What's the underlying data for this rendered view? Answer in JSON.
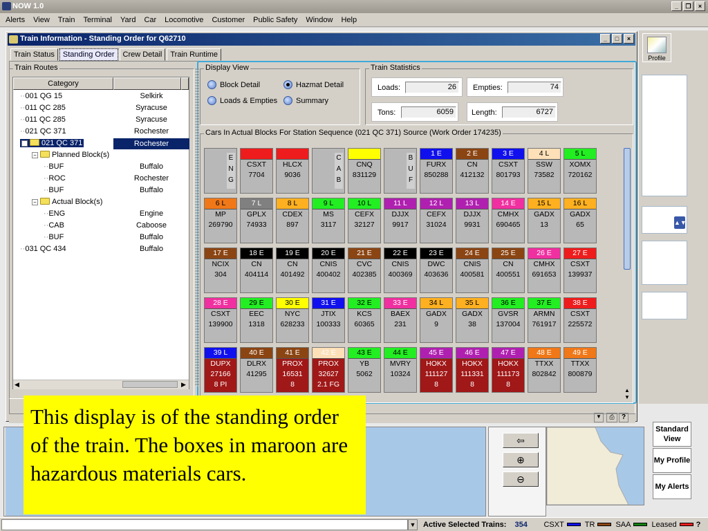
{
  "app": {
    "title": "NOW 1.0"
  },
  "menu": [
    "Alerts",
    "View",
    "Train",
    "Terminal",
    "Yard",
    "Car",
    "Locomotive",
    "Customer",
    "Public Safety",
    "Window",
    "Help"
  ],
  "window": {
    "title": "Train Information - Standing Order for Q62710"
  },
  "tabs": [
    "Train Status",
    "Standing Order",
    "Crew Detail",
    "Train Runtime"
  ],
  "routes": {
    "label": "Train Routes",
    "header": "Category",
    "rows": [
      {
        "name": "001 QG  15",
        "place": "Selkirk",
        "indent": 0
      },
      {
        "name": "011 QC 285",
        "place": "Syracuse",
        "indent": 0
      },
      {
        "name": "011 QC 285",
        "place": "Syracuse",
        "indent": 0
      },
      {
        "name": "021 QC 371",
        "place": "Rochester",
        "indent": 0
      },
      {
        "name": "021 QC 371",
        "place": "Rochester",
        "indent": 0,
        "selected": true,
        "folder": true
      },
      {
        "name": "Planned Block(s)",
        "place": "",
        "indent": 1,
        "folder": true
      },
      {
        "name": "BUF",
        "place": "Buffalo",
        "indent": 2
      },
      {
        "name": "ROC",
        "place": "Rochester",
        "indent": 2
      },
      {
        "name": "BUF",
        "place": "Buffalo",
        "indent": 2
      },
      {
        "name": "Actual Block(s)",
        "place": "",
        "indent": 1,
        "folder": true
      },
      {
        "name": "ENG",
        "place": "Engine",
        "indent": 2
      },
      {
        "name": "CAB",
        "place": "Caboose",
        "indent": 2
      },
      {
        "name": "BUF",
        "place": "Buffalo",
        "indent": 2
      },
      {
        "name": "031 QC 434",
        "place": "Buffalo",
        "indent": 0
      }
    ]
  },
  "display_view": {
    "label": "Display View",
    "options": [
      "Block Detail",
      "Hazmat Detail",
      "Loads & Empties",
      "Summary"
    ],
    "selected": "Hazmat Detail"
  },
  "stats": {
    "label": "Train Statistics",
    "loads_label": "Loads:",
    "loads": "26",
    "empties_label": "Empties:",
    "empties": "74",
    "tons_label": "Tons:",
    "tons": "6059",
    "length_label": "Length:",
    "length": "6727"
  },
  "cars_label": "Cars In Actual Blocks For Station Sequence (021 QC 371)  Source (Work Order 174235)",
  "cars": [
    [
      {
        "vert": "ENG"
      },
      {
        "hd": "",
        "hc": "#ee1c1c",
        "l1": "CSXT",
        "l2": "7704"
      },
      {
        "hd": "",
        "hc": "#ee1c1c",
        "l1": "HLCX",
        "l2": "9036"
      },
      {
        "vert": "CAB"
      },
      {
        "hd": "",
        "hc": "#ffff00",
        "l1": "CNQ",
        "l2": "831129"
      },
      {
        "vert": "BUF"
      },
      {
        "hd": "1  E",
        "hc": "#1010ee",
        "hf": "#fff",
        "l1": "FURX",
        "l2": "850288"
      },
      {
        "hd": "2  E",
        "hc": "#8b4513",
        "hf": "#fff",
        "l1": "CN",
        "l2": "412132"
      },
      {
        "hd": "3  E",
        "hc": "#1010ee",
        "hf": "#fff",
        "l1": "CSXT",
        "l2": "801793"
      },
      {
        "hd": "4  L",
        "hc": "#fde0b8",
        "l1": "SSW",
        "l2": "73582"
      },
      {
        "hd": "5  L",
        "hc": "#22ee22",
        "l1": "XOMX",
        "l2": "720162"
      }
    ],
    [
      {
        "hd": "6  L",
        "hc": "#f07818",
        "l1": "MP",
        "l2": "269790"
      },
      {
        "hd": "7  L",
        "hc": "#808080",
        "hf": "#fff",
        "l1": "GPLX",
        "l2": "74933"
      },
      {
        "hd": "8  L",
        "hc": "#ffb020",
        "l1": "CDEX",
        "l2": "897"
      },
      {
        "hd": "9  L",
        "hc": "#22ee22",
        "l1": "MS",
        "l2": "3117"
      },
      {
        "hd": "10  L",
        "hc": "#22ee22",
        "l1": "CEFX",
        "l2": "32127"
      },
      {
        "hd": "11  L",
        "hc": "#b020b0",
        "hf": "#fff",
        "l1": "DJJX",
        "l2": "9917"
      },
      {
        "hd": "12  L",
        "hc": "#b020b0",
        "hf": "#fff",
        "l1": "CEFX",
        "l2": "31024"
      },
      {
        "hd": "13  L",
        "hc": "#b020b0",
        "hf": "#fff",
        "l1": "DJJX",
        "l2": "9931"
      },
      {
        "hd": "14  E",
        "hc": "#f030a0",
        "hf": "#fff",
        "l1": "CMHX",
        "l2": "690465"
      },
      {
        "hd": "15  L",
        "hc": "#ffb020",
        "l1": "GADX",
        "l2": "13"
      },
      {
        "hd": "16  L",
        "hc": "#ffb020",
        "l1": "GADX",
        "l2": "65"
      }
    ],
    [
      {
        "hd": "17  E",
        "hc": "#8b4513",
        "hf": "#fff",
        "l1": "NCIX",
        "l2": "304"
      },
      {
        "hd": "18  E",
        "hc": "#000",
        "hf": "#fff",
        "l1": "CN",
        "l2": "404114"
      },
      {
        "hd": "19  E",
        "hc": "#000",
        "hf": "#fff",
        "l1": "CN",
        "l2": "401492"
      },
      {
        "hd": "20  E",
        "hc": "#000",
        "hf": "#fff",
        "l1": "CNIS",
        "l2": "400402"
      },
      {
        "hd": "21  E",
        "hc": "#8b4513",
        "hf": "#fff",
        "l1": "CVC",
        "l2": "402385"
      },
      {
        "hd": "22  E",
        "hc": "#000",
        "hf": "#fff",
        "l1": "CNIS",
        "l2": "400369"
      },
      {
        "hd": "23  E",
        "hc": "#000",
        "hf": "#fff",
        "l1": "DWC",
        "l2": "403636"
      },
      {
        "hd": "24  E",
        "hc": "#8b4513",
        "hf": "#fff",
        "l1": "CNIS",
        "l2": "400581"
      },
      {
        "hd": "25  E",
        "hc": "#8b4513",
        "hf": "#fff",
        "l1": "CN",
        "l2": "400551"
      },
      {
        "hd": "26  E",
        "hc": "#f030a0",
        "hf": "#fff",
        "l1": "CMHX",
        "l2": "691653"
      },
      {
        "hd": "27  E",
        "hc": "#ee1c1c",
        "hf": "#fff",
        "l1": "CSXT",
        "l2": "139937"
      }
    ],
    [
      {
        "hd": "28  E",
        "hc": "#f030a0",
        "hf": "#fff",
        "l1": "CSXT",
        "l2": "139900"
      },
      {
        "hd": "29  E",
        "hc": "#22ee22",
        "l1": "EEC",
        "l2": "1318"
      },
      {
        "hd": "30  E",
        "hc": "#ffff00",
        "l1": "NYC",
        "l2": "628233"
      },
      {
        "hd": "31  E",
        "hc": "#1010ee",
        "hf": "#fff",
        "l1": "JTIX",
        "l2": "100333"
      },
      {
        "hd": "32  E",
        "hc": "#22ee22",
        "l1": "KCS",
        "l2": "60365"
      },
      {
        "hd": "33  E",
        "hc": "#f030a0",
        "hf": "#fff",
        "l1": "BAEX",
        "l2": "231"
      },
      {
        "hd": "34  L",
        "hc": "#ffb020",
        "l1": "GADX",
        "l2": "9"
      },
      {
        "hd": "35  L",
        "hc": "#ffb020",
        "l1": "GADX",
        "l2": "38"
      },
      {
        "hd": "36  E",
        "hc": "#22ee22",
        "l1": "GVSR",
        "l2": "137004"
      },
      {
        "hd": "37  E",
        "hc": "#22ee22",
        "l1": "ARMN",
        "l2": "761917"
      },
      {
        "hd": "38  E",
        "hc": "#ee1c1c",
        "hf": "#fff",
        "l1": "CSXT",
        "l2": "225572"
      }
    ],
    [
      {
        "hd": "39  L",
        "hc": "#1010ee",
        "hf": "#fff",
        "l1": "DUPX",
        "l2": "27166",
        "l3": "8  PI",
        "hz": true
      },
      {
        "hd": "40  E",
        "hc": "#8b4513",
        "hf": "#fff",
        "l1": "DLRX",
        "l2": "41295"
      },
      {
        "hd": "41  E",
        "hc": "#8b4513",
        "hf": "#fff",
        "l1": "PROX",
        "l2": "16531",
        "l3": "8",
        "hz": true
      },
      {
        "hd": "42  E",
        "hc": "#fde0b8",
        "l1": "PROX",
        "l2": "32627",
        "l3": "2.1  FG",
        "hz": true
      },
      {
        "hd": "43  E",
        "hc": "#22ee22",
        "l1": "YB",
        "l2": "5062"
      },
      {
        "hd": "44  E",
        "hc": "#22ee22",
        "l1": "MVRY",
        "l2": "10324"
      },
      {
        "hd": "45  E",
        "hc": "#b020b0",
        "hf": "#fff",
        "l1": "HOKX",
        "l2": "111127",
        "l3": "8",
        "hz": true
      },
      {
        "hd": "46  E",
        "hc": "#b020b0",
        "hf": "#fff",
        "l1": "HOKX",
        "l2": "111331",
        "l3": "8",
        "hz": true
      },
      {
        "hd": "47  E",
        "hc": "#b020b0",
        "hf": "#fff",
        "l1": "HOKX",
        "l2": "111173",
        "l3": "8",
        "hz": true
      },
      {
        "hd": "48  E",
        "hc": "#f07818",
        "hf": "#fff",
        "l1": "TTXX",
        "l2": "802842"
      },
      {
        "hd": "49  E",
        "hc": "#f07818",
        "hf": "#fff",
        "l1": "TTXX",
        "l2": "800879"
      }
    ]
  ],
  "profile_label": "Profile",
  "side_buttons": [
    "Standard View",
    "My Profile",
    "My Alerts"
  ],
  "zoom_icons": [
    "⇦",
    "⊕",
    "⊖"
  ],
  "status": {
    "active_label": "Active Selected Trains:",
    "active_count": "354",
    "legend": [
      "CSXT",
      "TR",
      "SAA",
      "Leased"
    ],
    "legend_colors": [
      "#1010ee",
      "#8b4513",
      "#108010",
      "#ee1c1c"
    ],
    "help": "?"
  },
  "caption": "This display is of the standing order of the train. The boxes in maroon are hazardous materials cars."
}
